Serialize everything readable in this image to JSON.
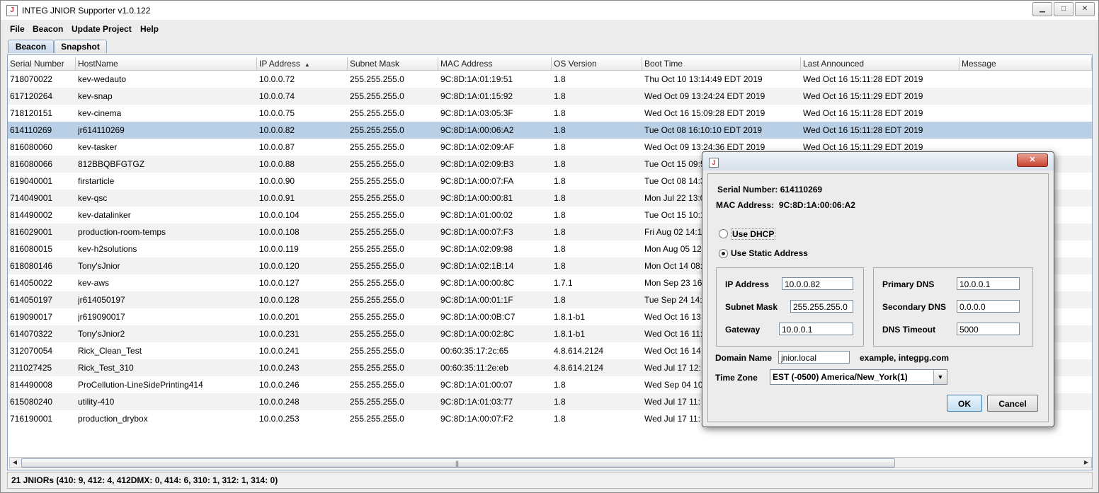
{
  "window": {
    "title": "INTEG JNIOR Supporter v1.0.122",
    "minimize": "▁",
    "maximize": "□",
    "close": "✕"
  },
  "menu": [
    "File",
    "Beacon",
    "Update Project",
    "Help"
  ],
  "tabs": [
    {
      "label": "Beacon",
      "active": true
    },
    {
      "label": "Snapshot",
      "active": false
    }
  ],
  "table": {
    "columns": [
      "Serial Number",
      "HostName",
      "IP Address",
      "Subnet Mask",
      "MAC Address",
      "OS Version",
      "Boot Time",
      "Last Announced",
      "Message"
    ],
    "sorted_column": "IP Address",
    "rows": [
      [
        "718070022",
        "kev-wedauto",
        "10.0.0.72",
        "255.255.255.0",
        "9C:8D:1A:01:19:51",
        "1.8",
        "Thu Oct 10 13:14:49 EDT 2019",
        "Wed Oct 16 15:11:28 EDT 2019",
        ""
      ],
      [
        "617120264",
        "kev-snap",
        "10.0.0.74",
        "255.255.255.0",
        "9C:8D:1A:01:15:92",
        "1.8",
        "Wed Oct 09 13:24:24 EDT 2019",
        "Wed Oct 16 15:11:29 EDT 2019",
        ""
      ],
      [
        "718120151",
        "kev-cinema",
        "10.0.0.75",
        "255.255.255.0",
        "9C:8D:1A:03:05:3F",
        "1.8",
        "Wed Oct 16 15:09:28 EDT 2019",
        "Wed Oct 16 15:11:28 EDT 2019",
        ""
      ],
      [
        "614110269",
        "jr614110269",
        "10.0.0.82",
        "255.255.255.0",
        "9C:8D:1A:00:06:A2",
        "1.8",
        "Tue Oct 08 16:10:10 EDT 2019",
        "Wed Oct 16 15:11:28 EDT 2019",
        ""
      ],
      [
        "816080060",
        "kev-tasker",
        "10.0.0.87",
        "255.255.255.0",
        "9C:8D:1A:02:09:AF",
        "1.8",
        "Wed Oct 09 13:24:36 EDT 2019",
        "Wed Oct 16 15:11:29 EDT 2019",
        ""
      ],
      [
        "816080066",
        "812BBQBFGTGZ",
        "10.0.0.88",
        "255.255.255.0",
        "9C:8D:1A:02:09:B3",
        "1.8",
        "Tue Oct 15 09:5",
        "",
        ""
      ],
      [
        "619040001",
        "firstarticle",
        "10.0.0.90",
        "255.255.255.0",
        "9C:8D:1A:00:07:FA",
        "1.8",
        "Tue Oct 08 14:3",
        "",
        ""
      ],
      [
        "714049001",
        "kev-qsc",
        "10.0.0.91",
        "255.255.255.0",
        "9C:8D:1A:00:00:81",
        "1.8",
        "Mon Jul 22 13:0",
        "",
        ""
      ],
      [
        "814490002",
        "kev-datalinker",
        "10.0.0.104",
        "255.255.255.0",
        "9C:8D:1A:01:00:02",
        "1.8",
        "Tue Oct 15 10:1",
        "",
        ""
      ],
      [
        "816029001",
        "production-room-temps",
        "10.0.0.108",
        "255.255.255.0",
        "9C:8D:1A:00:07:F3",
        "1.8",
        "Fri Aug 02 14:1",
        "",
        ""
      ],
      [
        "816080015",
        "kev-h2solutions",
        "10.0.0.119",
        "255.255.255.0",
        "9C:8D:1A:02:09:98",
        "1.8",
        "Mon Aug 05 12:",
        "",
        ""
      ],
      [
        "618080146",
        "Tony'sJnior",
        "10.0.0.120",
        "255.255.255.0",
        "9C:8D:1A:02:1B:14",
        "1.8",
        "Mon Oct 14 08:",
        "",
        ""
      ],
      [
        "614050022",
        "kev-aws",
        "10.0.0.127",
        "255.255.255.0",
        "9C:8D:1A:00:00:8C",
        "1.7.1",
        "Mon Sep 23 16",
        "",
        ""
      ],
      [
        "614050197",
        "jr614050197",
        "10.0.0.128",
        "255.255.255.0",
        "9C:8D:1A:00:01:1F",
        "1.8",
        "Tue Sep 24 14:",
        "",
        ""
      ],
      [
        "619090017",
        "jr619090017",
        "10.0.0.201",
        "255.255.255.0",
        "9C:8D:1A:00:0B:C7",
        "1.8.1-b1",
        "Wed Oct 16 13:",
        "",
        ""
      ],
      [
        "614070322",
        "Tony'sJnior2",
        "10.0.0.231",
        "255.255.255.0",
        "9C:8D:1A:00:02:8C",
        "1.8.1-b1",
        "Wed Oct 16 11:",
        "",
        ""
      ],
      [
        "312070054",
        "Rick_Clean_Test",
        "10.0.0.241",
        "255.255.255.0",
        "00:60:35:17:2c:65",
        "4.8.614.2124",
        "Wed Oct 16 14:",
        "",
        ""
      ],
      [
        "211027425",
        "Rick_Test_310",
        "10.0.0.243",
        "255.255.255.0",
        "00:60:35:11:2e:eb",
        "4.8.614.2124",
        "Wed Jul 17 12:",
        "",
        ""
      ],
      [
        "814490008",
        "ProCellution-LineSidePrinting414",
        "10.0.0.246",
        "255.255.255.0",
        "9C:8D:1A:01:00:07",
        "1.8",
        "Wed Sep 04 10",
        "",
        ""
      ],
      [
        "615080240",
        "utility-410",
        "10.0.0.248",
        "255.255.255.0",
        "9C:8D:1A:01:03:77",
        "1.8",
        "Wed Jul 17 11:",
        "",
        ""
      ],
      [
        "716190001",
        "production_drybox",
        "10.0.0.253",
        "255.255.255.0",
        "9C:8D:1A:00:07:F2",
        "1.8",
        "Wed Jul 17 11:",
        "",
        ""
      ]
    ],
    "selected_row": 3
  },
  "status": "21 JNIORs (410: 9, 412: 4, 412DMX: 0, 414: 6, 310: 1, 312: 1, 314: 0)",
  "dialog": {
    "close": "✕",
    "serial_label": "Serial Number:",
    "serial_value": "614110269",
    "mac_label": "MAC Address:",
    "mac_value": "9C:8D:1A:00:06:A2",
    "dhcp_label": "Use DHCP",
    "static_label": "Use Static Address",
    "mode": "static",
    "ip_label": "IP Address",
    "ip_value": "10.0.0.82",
    "subnet_label": "Subnet Mask",
    "subnet_value": "255.255.255.0",
    "gateway_label": "Gateway",
    "gateway_value": "10.0.0.1",
    "primary_dns_label": "Primary DNS",
    "primary_dns_value": "10.0.0.1",
    "secondary_dns_label": "Secondary DNS",
    "secondary_dns_value": "0.0.0.0",
    "dns_timeout_label": "DNS Timeout",
    "dns_timeout_value": "5000",
    "domain_label": "Domain Name",
    "domain_value": "jnior.local",
    "domain_example": "example, integpg.com",
    "timezone_label": "Time Zone",
    "timezone_value": "EST  (-0500) America/New_York(1)",
    "ok_label": "OK",
    "cancel_label": "Cancel"
  },
  "colors": {
    "selection": "#b8cfe5",
    "accent": "#3c7fb1"
  }
}
